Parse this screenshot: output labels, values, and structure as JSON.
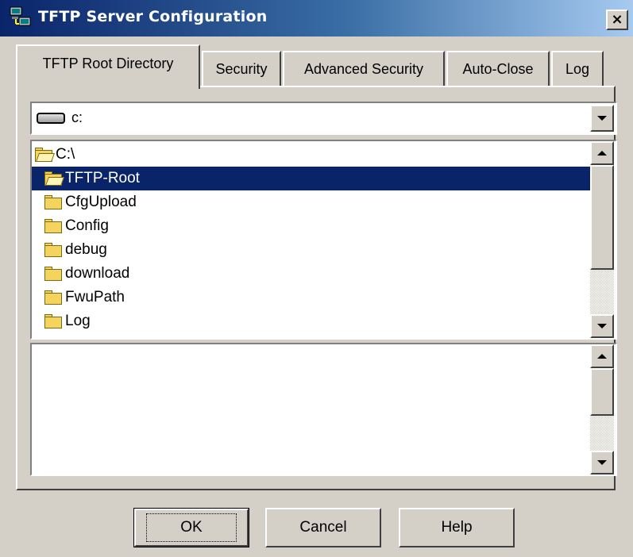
{
  "window": {
    "title": "TFTP Server Configuration",
    "close_label": "×"
  },
  "tabs": [
    {
      "label": "TFTP Root Directory",
      "active": true
    },
    {
      "label": "Security",
      "active": false
    },
    {
      "label": "Advanced Security",
      "active": false
    },
    {
      "label": "Auto-Close",
      "active": false
    },
    {
      "label": "Log",
      "active": false
    }
  ],
  "drive": {
    "value": "c:",
    "icon": "drive-icon"
  },
  "folders": {
    "items": [
      {
        "label": "C:\\",
        "icon": "open-folder-icon",
        "selected": false
      },
      {
        "label": "TFTP-Root",
        "icon": "open-folder-icon",
        "selected": true
      },
      {
        "label": "CfgUpload",
        "icon": "folder-icon",
        "selected": false
      },
      {
        "label": "Config",
        "icon": "folder-icon",
        "selected": false
      },
      {
        "label": "debug",
        "icon": "folder-icon",
        "selected": false
      },
      {
        "label": "download",
        "icon": "folder-icon",
        "selected": false
      },
      {
        "label": "FwuPath",
        "icon": "folder-icon",
        "selected": false
      },
      {
        "label": "Log",
        "icon": "folder-icon",
        "selected": false
      }
    ]
  },
  "buttons": {
    "ok": "OK",
    "cancel": "Cancel",
    "help": "Help"
  },
  "colors": {
    "selection": "#0a246a",
    "face": "#d4d0c8",
    "title_start": "#0a246a",
    "title_end": "#a6caf0"
  }
}
